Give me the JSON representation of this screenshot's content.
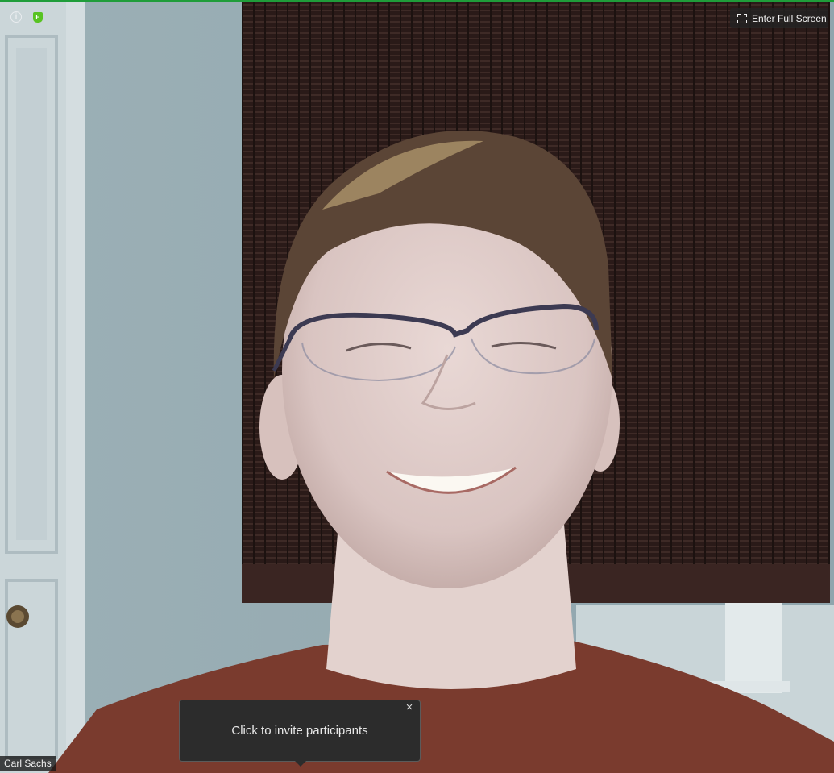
{
  "video": {
    "participant_name": "Carl Sachs"
  },
  "toolbar": {
    "fullscreen_label": "Enter Full Screen",
    "info_icon": "info-icon",
    "encryption_icon": "encryption-shield-icon",
    "encryption_letter": "E",
    "fullscreen_icon": "expand-icon"
  },
  "invite_tooltip": {
    "text": "Click to invite participants",
    "close_glyph": "×"
  },
  "colors": {
    "active_border": "#1f9d3a",
    "encryption_badge": "#58c322"
  }
}
